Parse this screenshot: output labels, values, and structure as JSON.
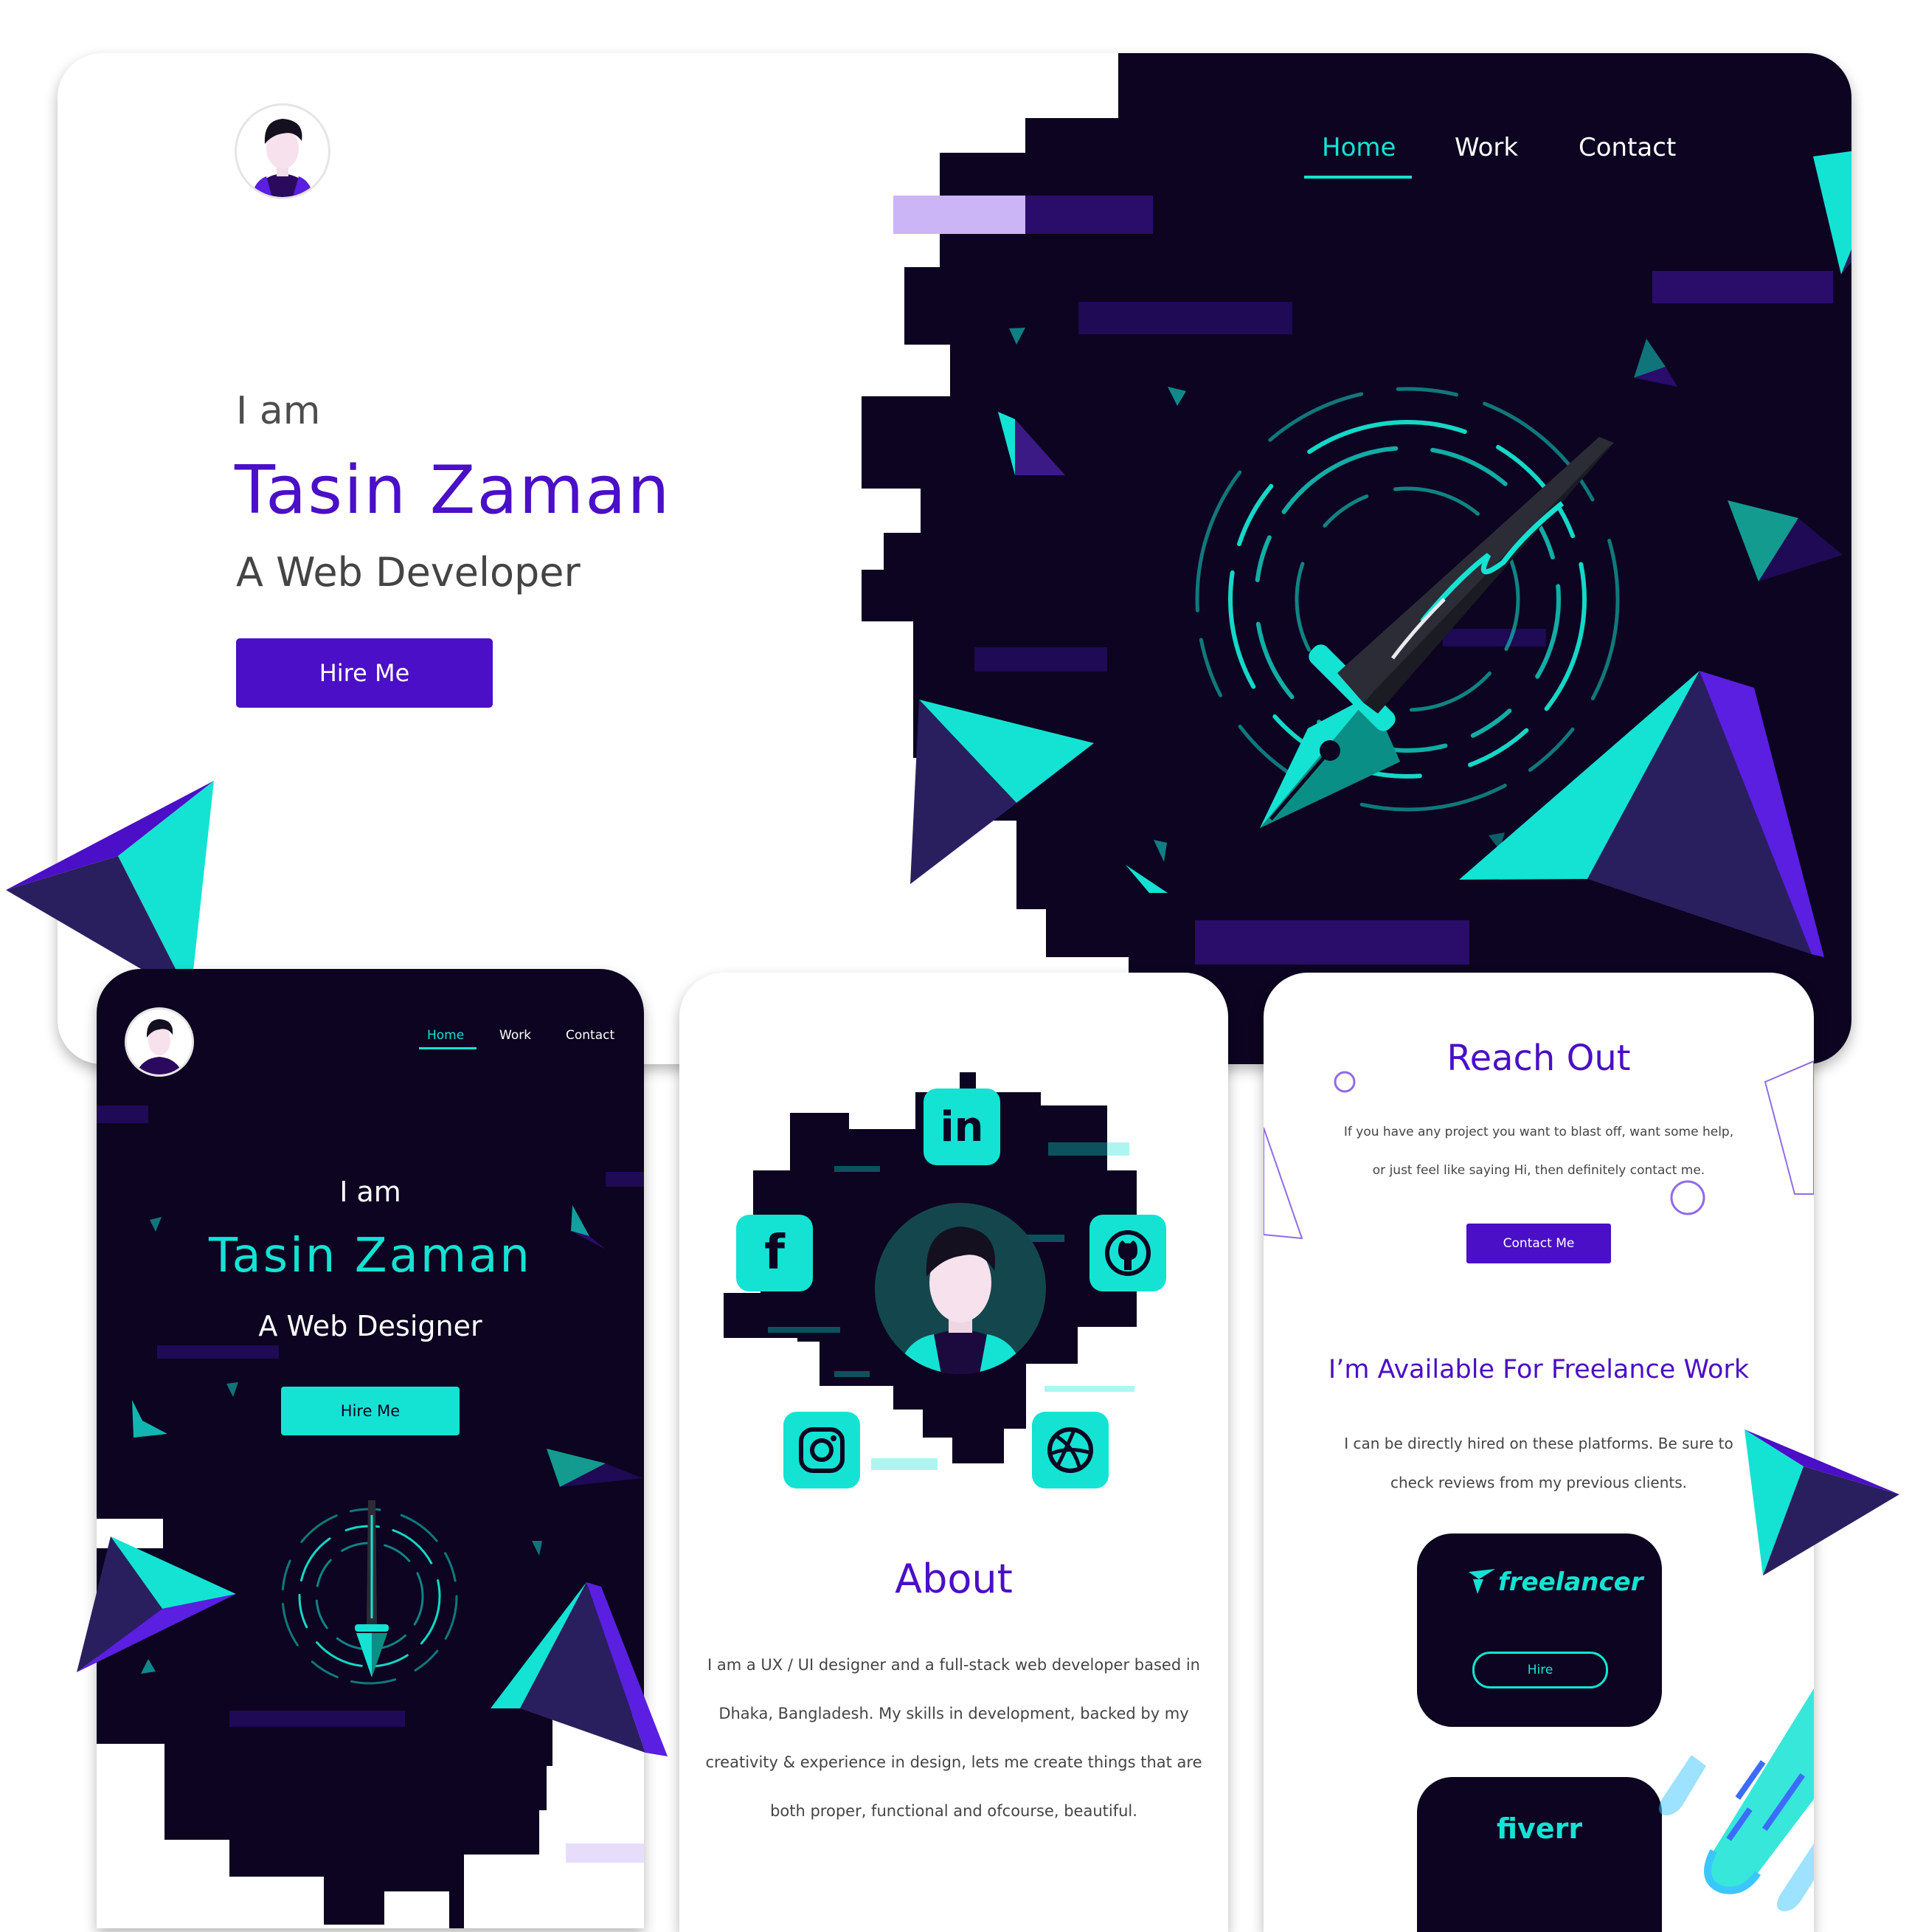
{
  "desktop": {
    "nav": [
      "Home",
      "Work",
      "Contact"
    ],
    "greeting": "I am",
    "name": "Tasin Zaman",
    "role": "A Web Developer",
    "cta": "Hire Me"
  },
  "mobile_home": {
    "nav": [
      "Home",
      "Work",
      "Contact"
    ],
    "greeting": "I am",
    "name": "Tasin Zaman",
    "role": "A Web Designer",
    "cta": "Hire Me"
  },
  "mobile_about": {
    "social_icons": [
      "linkedin-icon",
      "facebook-icon",
      "github-icon",
      "instagram-icon",
      "dribbble-icon"
    ],
    "title": "About",
    "body_lines": [
      "I am a UX / UI  designer and a full-stack web developer based in",
      "Dhaka, Bangladesh. My skills in development, backed by my",
      "creativity & experience in design, lets me create things that are",
      "both proper, functional and ofcourse, beautiful."
    ]
  },
  "mobile_contact": {
    "title": "Reach Out",
    "intro_lines": [
      "If you have any project you want to blast off, want some help,",
      "or just feel like saying Hi, then definitely contact me."
    ],
    "cta": "Contact Me",
    "freelance_title": "I’m Available For Freelance Work",
    "freelance_lines": [
      "I can be directly hired on these platforms. Be sure to",
      "check reviews from my previous clients."
    ],
    "platforms": [
      {
        "name": "freelancer",
        "button": "Hire"
      },
      {
        "name": "fiverr",
        "button": ""
      }
    ]
  },
  "colors": {
    "dark_bg": "#0c0420",
    "brand_purple": "#4a0fc6",
    "accent_teal": "#14e3d4",
    "light_lavender": "#cbb5f7"
  }
}
